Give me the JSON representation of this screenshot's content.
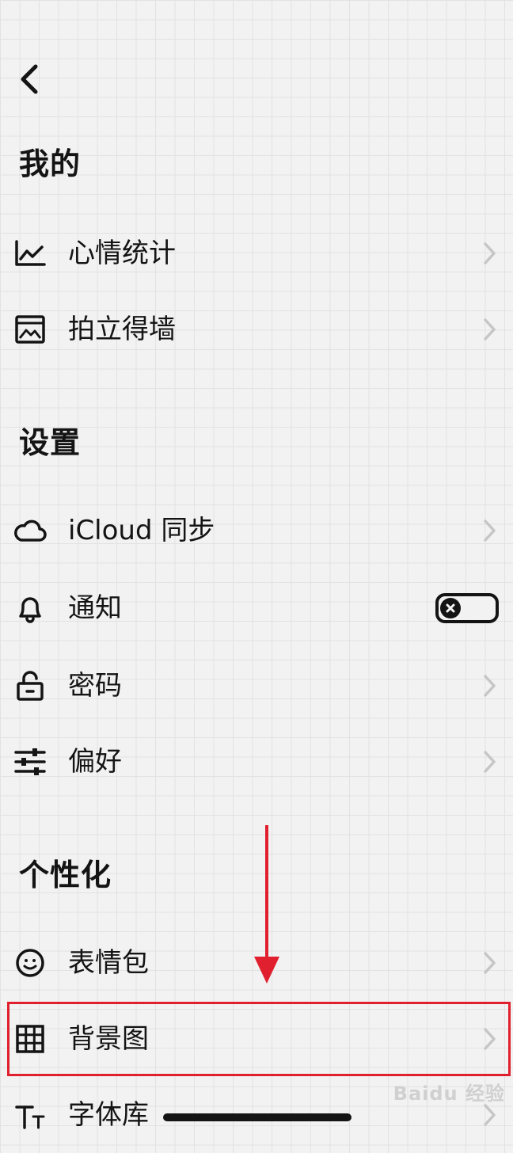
{
  "header": {
    "back_icon": "chevron-left-icon"
  },
  "sections": {
    "mine": {
      "title": "我的",
      "items": [
        {
          "label": "心情统计",
          "icon": "line-chart-icon"
        },
        {
          "label": "拍立得墙",
          "icon": "photo-wall-icon"
        }
      ]
    },
    "settings": {
      "title": "设置",
      "items": [
        {
          "label": "iCloud 同步",
          "icon": "cloud-icon"
        },
        {
          "label": "通知",
          "icon": "bell-icon",
          "toggle": "off"
        },
        {
          "label": "密码",
          "icon": "lock-icon"
        },
        {
          "label": "偏好",
          "icon": "sliders-icon"
        }
      ]
    },
    "personalize": {
      "title": "个性化",
      "items": [
        {
          "label": "表情包",
          "icon": "smiley-icon"
        },
        {
          "label": "背景图",
          "icon": "grid-icon",
          "highlighted": true
        },
        {
          "label": "字体库",
          "icon": "font-icon"
        }
      ]
    }
  },
  "watermark": "Baidu 经验",
  "colors": {
    "annotation": "#e0202e",
    "ink": "#141414",
    "background": "#f2f2f2"
  }
}
